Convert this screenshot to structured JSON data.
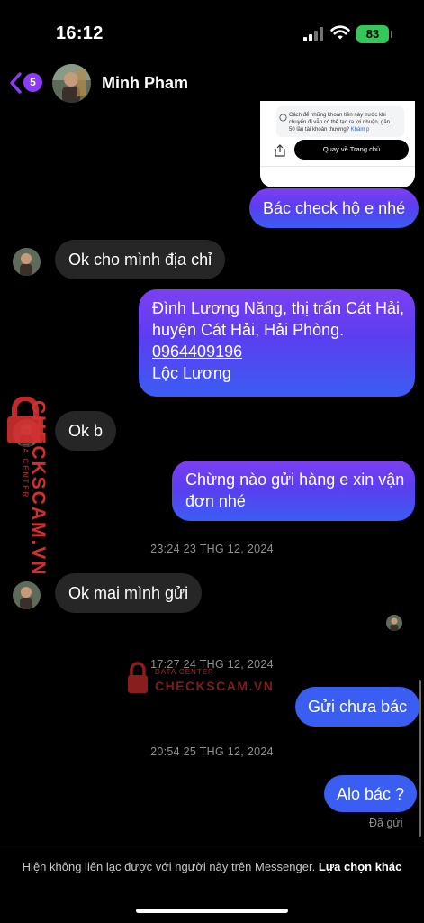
{
  "status_bar": {
    "time": "16:12",
    "battery": "83"
  },
  "header": {
    "back_badge": "5",
    "contact_name": "Minh Pham"
  },
  "shared_image": {
    "info_text": "Cách để những khoản tiền này trước khi chuyển đi vẫn có thể tạo ra lợi nhuận, gần 50 lần tài khoản thưởng?",
    "info_link": "Khám p",
    "button_label": "Quay về Trang chủ"
  },
  "messages": [
    {
      "side": "out",
      "text": "Bác check hộ e nhé"
    },
    {
      "side": "in",
      "text": "Ok cho mình địa chỉ"
    },
    {
      "side": "out",
      "lines": [
        "Đình Lương Năng, thị trấn Cát Hải,",
        "huyện Cát Hải, Hải Phòng."
      ],
      "phone": "0964409196",
      "last_line": "Lộc Lương"
    },
    {
      "side": "in",
      "text": "Ok b"
    },
    {
      "side": "out",
      "lines": [
        "Chừng nào gửi hàng e xin vận",
        "đơn nhé"
      ]
    },
    {
      "side": "in",
      "text": "Ok mai mình gửi"
    },
    {
      "side": "out",
      "text": "Gửi chưa bác"
    },
    {
      "side": "out",
      "text": "Alo bác ?"
    }
  ],
  "timestamps": [
    "23:24 23 THG 12, 2024",
    "17:27 24 THG 12, 2024",
    "20:54 25 THG 12, 2024"
  ],
  "seen_label": "Đã gửi",
  "footer": {
    "notice": "Hiện không liên lạc được với người này trên Messenger.",
    "action": "Lựa chọn khác"
  },
  "watermark": {
    "brand": "CHECKSCAM.VN",
    "sub": "DATA CENTER"
  },
  "colors": {
    "outgoing_top": "#7d3ff2",
    "outgoing_bottom": "#3a5df2",
    "incoming": "#262626",
    "badge": "#8b3cf7",
    "battery": "#34c759",
    "watermark": "#d32f2f"
  }
}
